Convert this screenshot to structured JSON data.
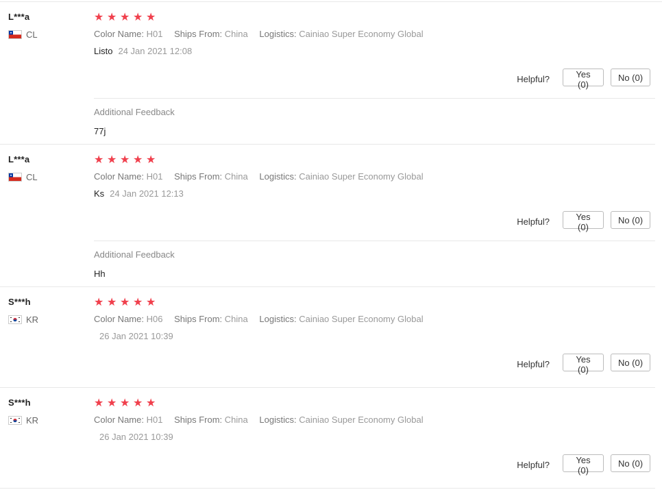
{
  "reviews": [
    {
      "user": "L***a",
      "country": "CL",
      "flag": "chile-flag",
      "rating": 5,
      "stars": [
        "★",
        "★",
        "★",
        "★",
        "★"
      ],
      "color_label": "Color Name:",
      "color_value": "H01",
      "ships_label": "Ships From:",
      "ships_value": "China",
      "logistics_label": "Logistics:",
      "logistics_value": "Cainiao Super Economy Global",
      "content": "Listo",
      "date": "24 Jan 2021 12:08",
      "helpful_label": "Helpful?",
      "yes_label": "Yes (0)",
      "no_label": "No (0)",
      "additional_title": "Additional Feedback",
      "additional_text": "77j"
    },
    {
      "user": "L***a",
      "country": "CL",
      "flag": "chile-flag",
      "rating": 5,
      "stars": [
        "★",
        "★",
        "★",
        "★",
        "★"
      ],
      "color_label": "Color Name:",
      "color_value": "H01",
      "ships_label": "Ships From:",
      "ships_value": "China",
      "logistics_label": "Logistics:",
      "logistics_value": "Cainiao Super Economy Global",
      "content": "Ks",
      "date": "24 Jan 2021 12:13",
      "helpful_label": "Helpful?",
      "yes_label": "Yes (0)",
      "no_label": "No (0)",
      "additional_title": "Additional Feedback",
      "additional_text": "Hh"
    },
    {
      "user": "S***h",
      "country": "KR",
      "flag": "south-korea-flag",
      "rating": 5,
      "stars": [
        "★",
        "★",
        "★",
        "★",
        "★"
      ],
      "color_label": "Color Name:",
      "color_value": "H06",
      "ships_label": "Ships From:",
      "ships_value": "China",
      "logistics_label": "Logistics:",
      "logistics_value": "Cainiao Super Economy Global",
      "content": "",
      "date": "26 Jan 2021 10:39",
      "helpful_label": "Helpful?",
      "yes_label": "Yes (0)",
      "no_label": "No (0)"
    },
    {
      "user": "S***h",
      "country": "KR",
      "flag": "south-korea-flag",
      "rating": 5,
      "stars": [
        "★",
        "★",
        "★",
        "★",
        "★"
      ],
      "color_label": "Color Name:",
      "color_value": "H01",
      "ships_label": "Ships From:",
      "ships_value": "China",
      "logistics_label": "Logistics:",
      "logistics_value": "Cainiao Super Economy Global",
      "content": "",
      "date": "26 Jan 2021 10:39",
      "helpful_label": "Helpful?",
      "yes_label": "Yes (0)",
      "no_label": "No (0)"
    }
  ],
  "colors": {
    "star": "#f0404d",
    "border": "#e8e8e8",
    "muted": "#999999"
  }
}
